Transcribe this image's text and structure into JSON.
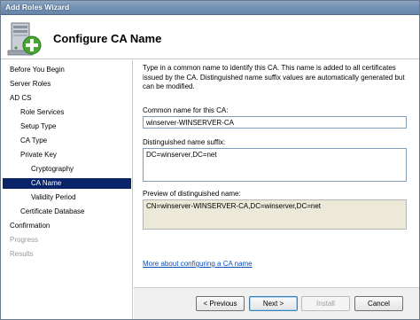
{
  "window": {
    "title": "Add Roles Wizard"
  },
  "header": {
    "title": "Configure CA Name",
    "icon": "server-add-icon"
  },
  "nav": {
    "items": [
      {
        "label": "Before You Begin",
        "state": "normal"
      },
      {
        "label": "Server Roles",
        "state": "normal"
      },
      {
        "label": "AD CS",
        "state": "normal"
      },
      {
        "label": "Role Services",
        "state": "normal"
      },
      {
        "label": "Setup Type",
        "state": "normal"
      },
      {
        "label": "CA Type",
        "state": "normal"
      },
      {
        "label": "Private Key",
        "state": "normal"
      },
      {
        "label": "Cryptography",
        "state": "normal"
      },
      {
        "label": "CA Name",
        "state": "selected"
      },
      {
        "label": "Validity Period",
        "state": "normal"
      },
      {
        "label": "Certificate Database",
        "state": "normal"
      },
      {
        "label": "Confirmation",
        "state": "normal"
      },
      {
        "label": "Progress",
        "state": "disabled"
      },
      {
        "label": "Results",
        "state": "disabled"
      }
    ]
  },
  "main": {
    "description": "Type in a common name to identify this CA. This name is added to all certificates issued by the CA. Distinguished name suffix values are automatically generated but can be modified.",
    "common_name_label": "Common name for this CA:",
    "common_name_value": "winserver-WINSERVER-CA",
    "dn_suffix_label": "Distinguished name suffix:",
    "dn_suffix_value": "DC=winserver,DC=net",
    "preview_label": "Preview of distinguished name:",
    "preview_value": "CN=winserver-WINSERVER-CA,DC=winserver,DC=net",
    "help_link": "More about configuring a CA name"
  },
  "buttons": {
    "previous": "< Previous",
    "next": "Next >",
    "install": "Install",
    "cancel": "Cancel"
  }
}
